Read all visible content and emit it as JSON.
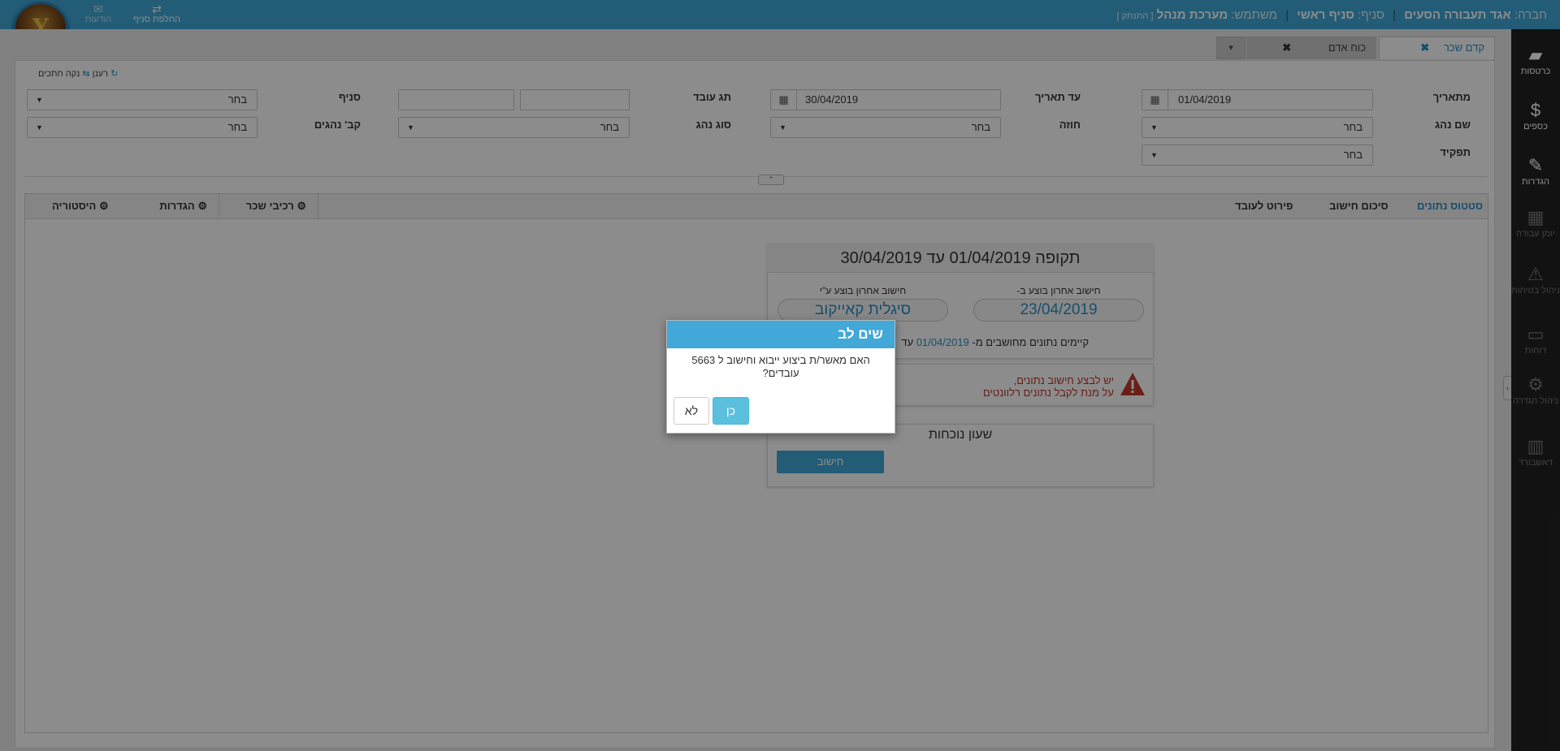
{
  "header": {
    "company_label": "חברה:",
    "company_name": "אגד תעבורה הסעים",
    "branch_label": "סניף:",
    "branch_name": "סניף ראשי",
    "user_label": "משתמש:",
    "user_name": "מערכת מנהל",
    "disconnect": "[ התנתק ]",
    "switch_branch": "החלפת סניף",
    "messages": "הודעות",
    "logo_text": "Y"
  },
  "sidebar": {
    "items": [
      {
        "label": "כרטסות",
        "icon": "folder-icon"
      },
      {
        "label": "כספים",
        "icon": "dollar-icon"
      },
      {
        "label": "הגדרות",
        "icon": "wrench-icon"
      },
      {
        "label": "יומן עבודה",
        "icon": "calendar-icon"
      },
      {
        "label": "ניהול בטיחות",
        "icon": "warning-icon"
      },
      {
        "label": "דוחות",
        "icon": "id-card-icon"
      },
      {
        "label": "ניהול הגדרה",
        "icon": "gear-icon"
      },
      {
        "label": "דאשבורד",
        "icon": "chart-icon"
      }
    ]
  },
  "tabs": {
    "active": "קדם שכר",
    "inactive": "כוח אדם",
    "close_glyph": "✖",
    "dropdown_glyph": "▾"
  },
  "filters": {
    "reset_refresh": "רענן",
    "reset_clear": "נקה חתכים",
    "from_date_label": "מתאריך",
    "from_date": "01/04/2019",
    "to_date_label": "עד תאריך",
    "to_date": "30/04/2019",
    "tag_label": "תג עובד",
    "branch_label": "סניף",
    "driver_name_label": "שם נהג",
    "contract_label": "חוזה",
    "driver_type_label": "סוג נהג",
    "driver_group_label": "קב' נהגים",
    "role_label": "תפקיד",
    "select_placeholder": "בחר"
  },
  "inner_tabs": {
    "right": [
      "סטטוס נתונים",
      "סיכום חישוב",
      "פירוט לעובד"
    ],
    "left": [
      "רכיבי שכר",
      "הגדרות",
      "היסטוריה"
    ]
  },
  "period_card": {
    "title": "תקופה 01/04/2019 עד 30/04/2019",
    "last_calc_on_label": "חישוב אחרון בוצע ב-",
    "last_calc_on": "23/04/2019",
    "last_calc_by_label": "חישוב אחרון בוצע ע\"י",
    "last_calc_by": "סיגלית קאייקוב",
    "exist_prefix": "קיימים נתונים מחושבים מ-",
    "exist_date": "01/04/2019",
    "exist_suffix": "עד"
  },
  "warning": {
    "line1": "יש לבצע חישוב נתונים,",
    "line2": "על מנת לקבל נתונים רלוונטים"
  },
  "attendance": {
    "title": "שעון נוכחות",
    "calc_button": "חישוב"
  },
  "modal": {
    "title": "שים לב",
    "message": "האם מאשר/ת ביצוע ייבוא וחישוב ל 5663 עובדים?",
    "yes": "כן",
    "no": "לא"
  },
  "colors": {
    "accent": "#41a8d8",
    "sidebar": "#222222",
    "warning": "#c0392b"
  }
}
